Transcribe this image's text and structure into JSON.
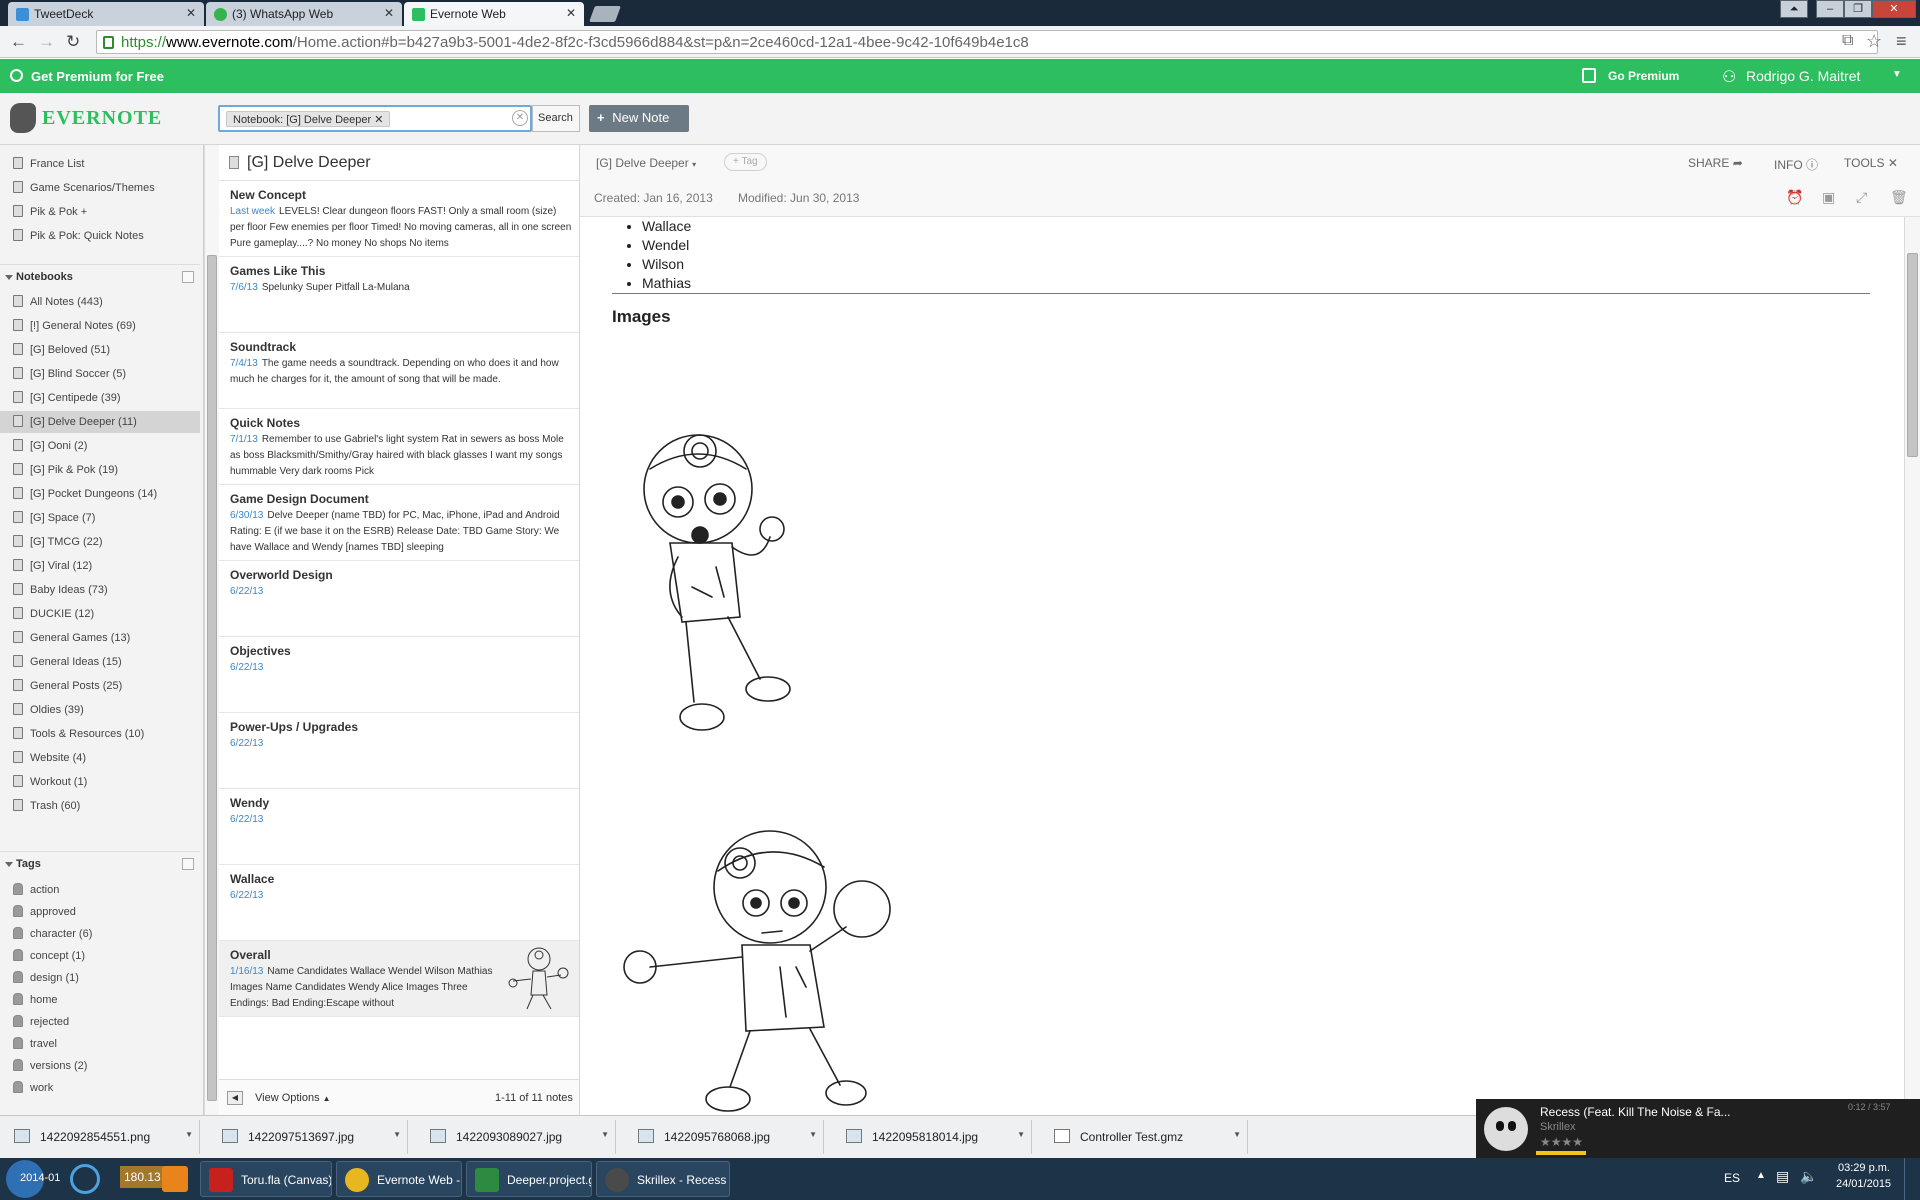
{
  "browser": {
    "tabs": [
      {
        "label": "TweetDeck",
        "color": "#3b8fd6"
      },
      {
        "label": "(3) WhatsApp Web",
        "color": "#36b44b"
      },
      {
        "label": "Evernote Web",
        "color": "#2dbe60"
      }
    ],
    "url": {
      "scheme": "https://",
      "host": "www.evernote.com",
      "rest": "/Home.action#b=b427a9b3-5001-4de2-8f2c-f3cd5966d884&st=p&n=2ce460cd-12a1-4bee-9c42-10f649b4e1c8"
    }
  },
  "premium_bar": {
    "left": "Get Premium for Free",
    "go_premium": "Go Premium",
    "user": "Rodrigo G. Maitret"
  },
  "header": {
    "logo": "EVERNOTE",
    "search_chip": "Notebook: [G] Delve Deeper",
    "search_button": "Search",
    "new_note": "New Note"
  },
  "sidebar": {
    "shortcuts": [
      "France List",
      "Game Scenarios/Themes",
      "Pik & Pok +",
      "Pik & Pok: Quick Notes"
    ],
    "notebooks_heading": "Notebooks",
    "notebooks": [
      "All Notes (443)",
      "[!] General Notes (69)",
      "[G] Beloved (51)",
      "[G] Blind Soccer (5)",
      "[G] Centipede (39)",
      "[G] Delve Deeper (11)",
      "[G] Ooni (2)",
      "[G] Pik & Pok (19)",
      "[G] Pocket Dungeons (14)",
      "[G] Space (7)",
      "[G] TMCG (22)",
      "[G] Viral (12)",
      "Baby Ideas (73)",
      "DUCKIE (12)",
      "General Games (13)",
      "General Ideas (15)",
      "General Posts (25)",
      "Oldies (39)",
      "Tools & Resources (10)",
      "Website (4)",
      "Workout (1)",
      "Trash (60)"
    ],
    "selected_notebook": 5,
    "tags_heading": "Tags",
    "tags": [
      "action",
      "approved",
      "character (6)",
      "concept (1)",
      "design (1)",
      "home",
      "rejected",
      "travel",
      "versions (2)",
      "work"
    ]
  },
  "notelist": {
    "title": "[G] Delve Deeper",
    "notes": [
      {
        "title": "New Concept",
        "date": "Last week",
        "snippet": "LEVELS! Clear dungeon floors FAST! Only a small room (size) per floor Few enemies per floor Timed! No moving cameras, all in one screen Pure gameplay....? No money No shops No items"
      },
      {
        "title": "Games Like This",
        "date": "7/6/13",
        "snippet": "Spelunky Super Pitfall La-Mulana"
      },
      {
        "title": "Soundtrack",
        "date": "7/4/13",
        "snippet": "The game needs a soundtrack. Depending on who does it and how much he charges for it, the amount of song that will be made."
      },
      {
        "title": "Quick Notes",
        "date": "7/1/13",
        "snippet": "Remember to use Gabriel's light system Rat in sewers as boss Mole as boss Blacksmith/Smithy/Gray haired with black glasses I want my songs hummable Very dark rooms Pick"
      },
      {
        "title": "Game Design Document",
        "date": "6/30/13",
        "snippet": "Delve Deeper (name TBD) for PC, Mac, iPhone, iPad and Android Rating: E (if we base it on the ESRB) Release Date: TBD Game Story: We have Wallace and Wendy [names TBD] sleeping"
      },
      {
        "title": "Overworld Design",
        "date": "6/22/13",
        "snippet": ""
      },
      {
        "title": "Objectives",
        "date": "6/22/13",
        "snippet": ""
      },
      {
        "title": "Power-Ups / Upgrades",
        "date": "6/22/13",
        "snippet": ""
      },
      {
        "title": "Wendy",
        "date": "6/22/13",
        "snippet": ""
      },
      {
        "title": "Wallace",
        "date": "6/22/13",
        "snippet": ""
      },
      {
        "title": "Overall",
        "date": "1/16/13",
        "snippet": "Name Candidates Wallace Wendel Wilson Mathias Images Name Candidates Wendy Alice Images Three Endings: Bad Ending:Escape without"
      }
    ],
    "selected_note": 10,
    "view_options": "View Options",
    "count": "1-11 of 11 notes"
  },
  "note": {
    "notebook": "[G] Delve Deeper",
    "tag_button": "+ Tag",
    "share": "SHARE",
    "info": "INFO",
    "tools": "TOOLS",
    "created": "Created: Jan 16, 2013",
    "modified": "Modified: Jun 30, 2013",
    "names": [
      "Wallace",
      "Wendel",
      "Wilson",
      "Mathias"
    ],
    "images_heading": "Images"
  },
  "downloads": [
    "1422092854551.png",
    "1422097513697.jpg",
    "1422093089027.jpg",
    "1422095768068.jpg",
    "1422095818014.jpg",
    "Controller Test.gmz"
  ],
  "music": {
    "title": "Recess (Feat. Kill The Noise & Fa...",
    "artist": "Skrillex",
    "time": "0:12 / 3:57"
  },
  "taskbar": {
    "items": [
      {
        "label": "Toru.fla (Canvas)",
        "color": "#c6211d"
      },
      {
        "label": "Evernote Web - G...",
        "color": "#e8b71f"
      },
      {
        "label": "Deeper.project.g...",
        "color": "#2c8b3f"
      },
      {
        "label": "Skrillex - Recess (F...",
        "color": "#4a4a4a"
      }
    ],
    "pinned_text": "180.13",
    "lang": "ES",
    "time": "03:29 p.m.",
    "date": "24/01/2015"
  },
  "colors": {
    "accent": "#2dbe60",
    "link": "#3a87c8"
  }
}
